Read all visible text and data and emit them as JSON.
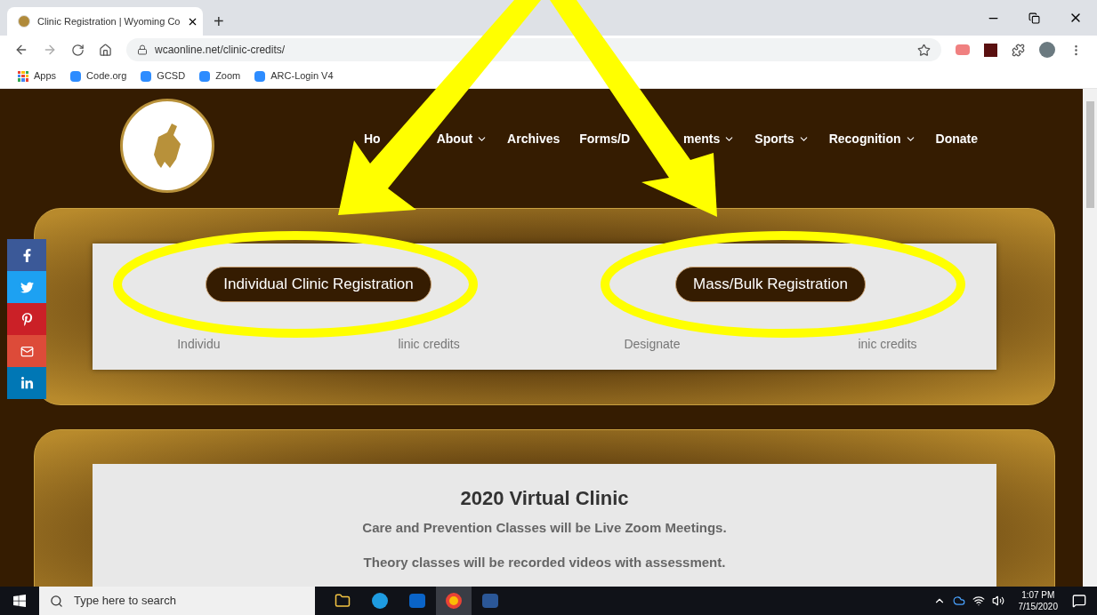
{
  "browser": {
    "tab_title": "Clinic Registration | Wyoming Co",
    "new_tab": "+",
    "url": "wcaonline.net/clinic-credits/",
    "bookmarks": [
      "Apps",
      "Code.org",
      "GCSD",
      "Zoom",
      "ARC-Login V4"
    ]
  },
  "nav": [
    {
      "parts": [
        "Ho"
      ],
      "dropdown": false
    },
    {
      "parts": [
        "About"
      ],
      "dropdown": true
    },
    {
      "parts": [
        "Archives"
      ],
      "dropdown": false
    },
    {
      "parts": [
        "Forms/D",
        "ments"
      ],
      "dropdown": true
    },
    {
      "parts": [
        "Sports"
      ],
      "dropdown": true
    },
    {
      "parts": [
        "Recognition"
      ],
      "dropdown": true
    },
    {
      "parts": [
        "Donate"
      ],
      "dropdown": false
    }
  ],
  "social": [
    {
      "kind": "facebook",
      "color": "#3b5998"
    },
    {
      "kind": "twitter",
      "color": "#1da1f2"
    },
    {
      "kind": "pinterest",
      "color": "#cb2027"
    },
    {
      "kind": "email",
      "color": "#dd4b39"
    },
    {
      "kind": "linkedin",
      "color": "#0077b5"
    }
  ],
  "registration": [
    {
      "button": "Individual Clinic Registration",
      "description_parts": [
        "Individu",
        "linic credits"
      ]
    },
    {
      "button": "Mass/Bulk Registration",
      "description_parts": [
        "Designate",
        "inic credits"
      ]
    }
  ],
  "clinic": {
    "title": "2020 Virtual Clinic",
    "lines": [
      "Care and Prevention Classes will be Live Zoom Meetings.",
      "Theory classes will be recorded videos with assessment."
    ]
  },
  "taskbar": {
    "search_placeholder": "Type here to search",
    "time": "1:07 PM",
    "date": "7/15/2020"
  }
}
